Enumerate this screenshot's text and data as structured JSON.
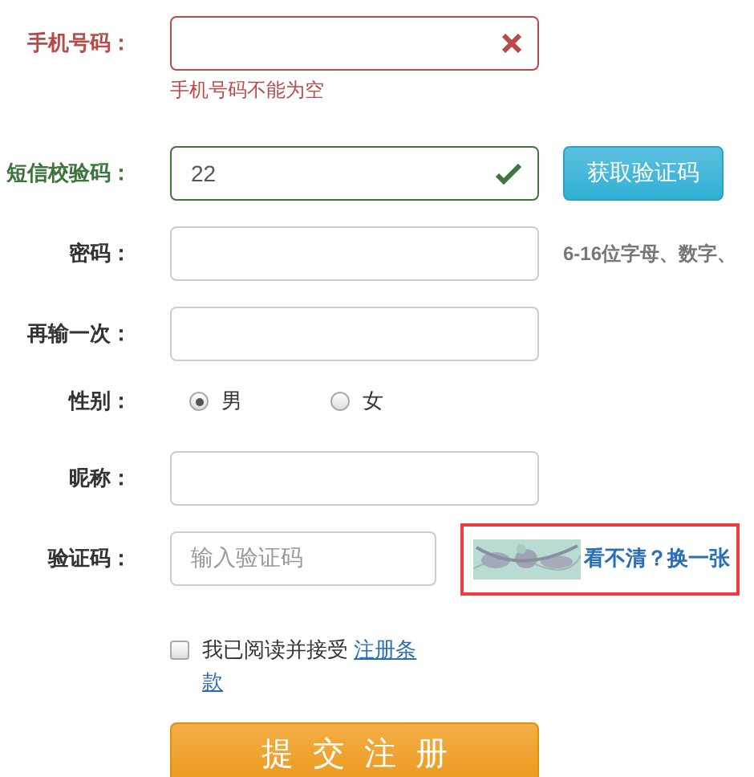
{
  "fields": [
    {
      "kind": "text",
      "label": "手机号码：",
      "invalid": true,
      "valid": false,
      "error": "手机号码不能为空"
    },
    {
      "kind": "text",
      "label": "短信校验码：",
      "invalid": false,
      "valid": true,
      "value": "22",
      "button": "获取验证码"
    },
    {
      "kind": "text",
      "label": "密码：",
      "invalid": false,
      "valid": false,
      "hint": "6-16位字母、数字、"
    },
    {
      "kind": "text",
      "label": "再输一次：",
      "invalid": false,
      "valid": false
    },
    {
      "kind": "radio",
      "label": "性别：",
      "options": [
        {
          "label": "男",
          "selected": true
        },
        {
          "label": "女",
          "selected": false
        }
      ]
    },
    {
      "kind": "text",
      "label": "昵称：",
      "invalid": false,
      "valid": false
    },
    {
      "kind": "captcha",
      "label": "验证码：",
      "placeholder": "输入验证码",
      "link": "看不清？换一张",
      "highlighted": true
    }
  ],
  "agreement": {
    "checked": false,
    "text": "我已阅读并接受",
    "link": "注册条款"
  },
  "submit": "提交注册"
}
